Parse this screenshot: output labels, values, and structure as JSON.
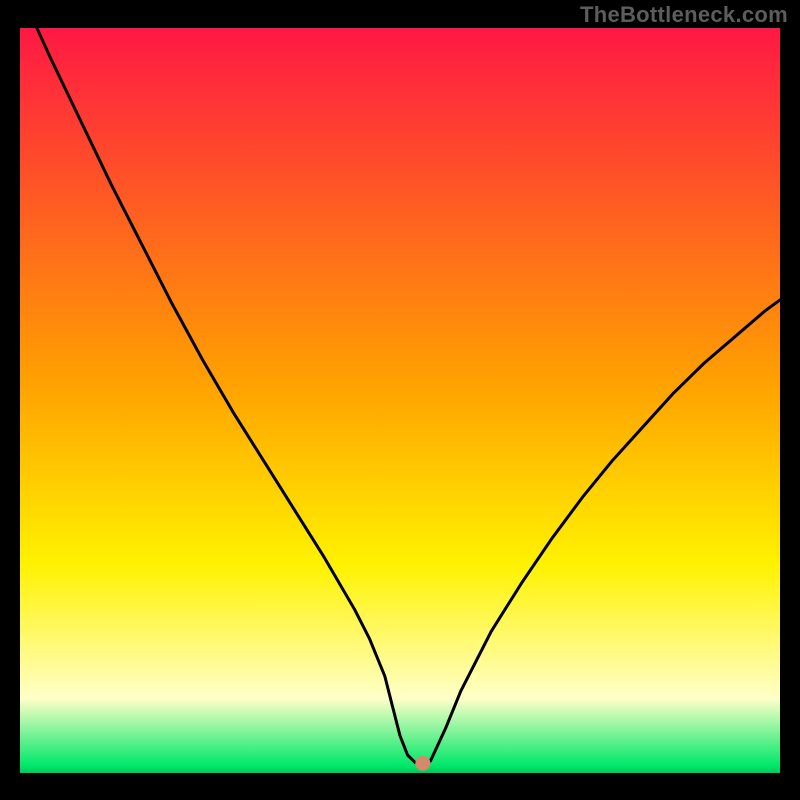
{
  "watermark": "TheBottleneck.com",
  "colors": {
    "background": "#000000",
    "curve": "#000000",
    "marker_fill": "#d4886c",
    "marker_stroke": "#d4886c",
    "gradient_top": "#ff1844",
    "gradient_mid_upper": "#ffa200",
    "gradient_mid_lower": "#fff200",
    "gradient_pale": "#ffffc8",
    "gradient_green": "#00e86a"
  },
  "chart_data": {
    "type": "line",
    "title": "",
    "xlabel": "",
    "ylabel": "",
    "xlim": [
      0,
      100
    ],
    "ylim": [
      0,
      100
    ],
    "curve": {
      "x": [
        0,
        4,
        8,
        12,
        16,
        20,
        24,
        28,
        32,
        36,
        40,
        44,
        46,
        48,
        49,
        50,
        51,
        52,
        53,
        54,
        56,
        58,
        62,
        66,
        70,
        74,
        78,
        82,
        86,
        90,
        94,
        98,
        100
      ],
      "y": [
        105,
        96,
        87.5,
        79,
        71,
        63,
        55.5,
        48.5,
        42,
        35.5,
        29,
        22,
        18,
        13,
        9,
        5,
        2.4,
        1.4,
        1.4,
        1.6,
        6,
        11,
        19,
        25.5,
        31.5,
        37,
        42,
        46.5,
        51,
        55,
        58.5,
        62,
        63.5
      ]
    },
    "marker": {
      "x": 53,
      "y": 1.3,
      "radius_px": 7
    }
  }
}
